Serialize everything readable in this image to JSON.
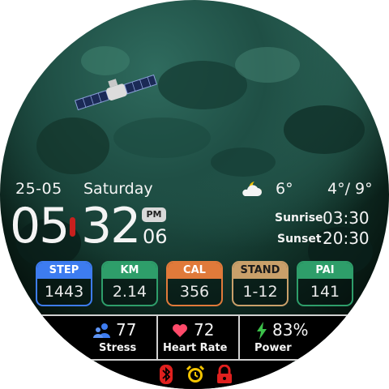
{
  "date": {
    "day_month": "25-05",
    "weekday": "Saturday"
  },
  "time": {
    "hours": "05",
    "minutes": "32",
    "seconds": "06",
    "ampm": "PM"
  },
  "weather": {
    "icon": "partly-cloudy-night-icon",
    "temp": "6°",
    "range": "4°/ 9°"
  },
  "sun": {
    "sunrise_label": "Sunrise",
    "sunrise": "03:30",
    "sunset_label": "Sunset",
    "sunset": "20:30"
  },
  "stats": [
    {
      "label": "STEP",
      "value": "1443",
      "color": "#3d7cf0"
    },
    {
      "label": "KM",
      "value": "2.14",
      "color": "#2e9e6a"
    },
    {
      "label": "CAL",
      "value": "356",
      "color": "#e07a3a"
    },
    {
      "label": "STAND",
      "value": "1-12",
      "color": "#c9a06a"
    },
    {
      "label": "PAI",
      "value": "141",
      "color": "#2e9e6a"
    }
  ],
  "metrics": {
    "stress": {
      "value": "77",
      "label": "Stress",
      "icon": "people-icon",
      "color": "#3d7cf0"
    },
    "heart": {
      "value": "72",
      "label": "Heart Rate",
      "icon": "heart-icon",
      "color": "#ff4a6a"
    },
    "power": {
      "value": "83%",
      "label": "Power",
      "icon": "lightning-icon",
      "color": "#3cc24a"
    }
  },
  "status_icons": [
    "bluetooth-icon",
    "alarm-icon",
    "lock-icon"
  ],
  "colors": {
    "accent_red": "#c8201e",
    "status_red": "#e0201e",
    "alarm_yellow": "#f2c300"
  }
}
